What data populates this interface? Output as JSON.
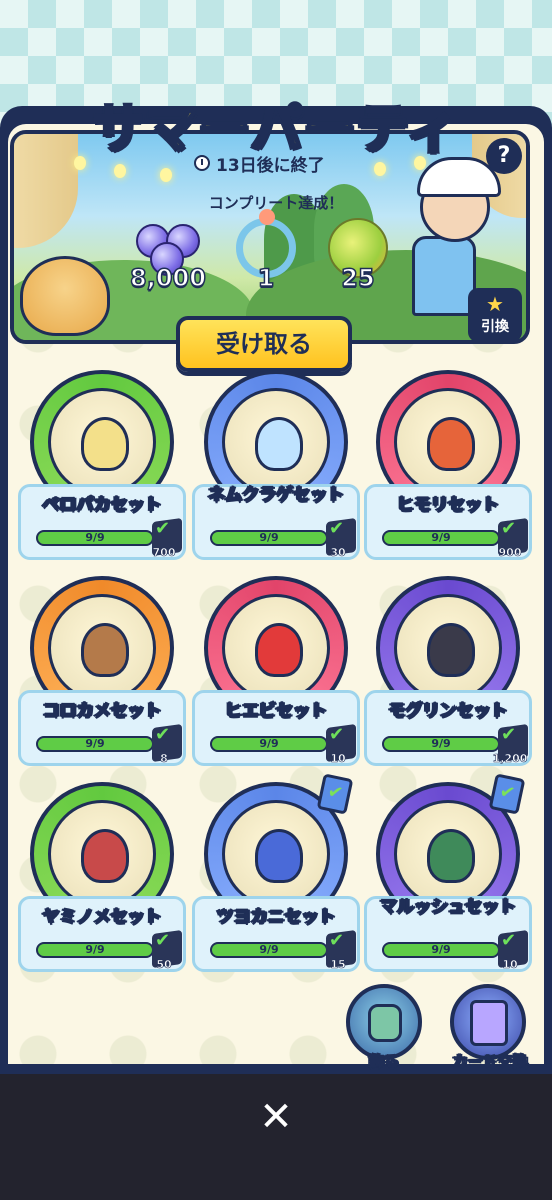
{
  "event": {
    "title": "サマーパーティ",
    "timer": "13日後に終了",
    "complete_label": "コンプリート達成！",
    "help": "?",
    "rewards": [
      {
        "icon": "gem-icon",
        "value": "8,000"
      },
      {
        "icon": "wreath-icon",
        "value": "1"
      },
      {
        "icon": "fruit-icon",
        "value": "25"
      }
    ],
    "exchange_label": "引換",
    "receive_label": "受け取る"
  },
  "sets": [
    {
      "name": "ペロパカセット",
      "progress": "9/9",
      "count": "700",
      "color": "#62c93f"
    },
    {
      "name": "ネムクラゲセット",
      "progress": "9/9",
      "count": "30",
      "color": "#5b86e8"
    },
    {
      "name": "ヒモリセット",
      "progress": "9/9",
      "count": "900",
      "color": "#e2446a"
    },
    {
      "name": "コロカメセット",
      "progress": "9/9",
      "count": "8",
      "color": "#f08a2a"
    },
    {
      "name": "ヒエビセット",
      "progress": "9/9",
      "count": "10",
      "color": "#e2446a"
    },
    {
      "name": "モグリンセット",
      "progress": "9/9",
      "count": "1,200",
      "color": "#6a4ad0"
    },
    {
      "name": "ヤミノメセット",
      "progress": "9/9",
      "count": "50",
      "color": "#62c93f"
    },
    {
      "name": "ツヨカニセット",
      "progress": "9/9",
      "count": "15",
      "color": "#5b86e8"
    },
    {
      "name": "マルッシュセット",
      "progress": "9/9",
      "count": "10",
      "color": "#6a4ad0"
    }
  ],
  "buttons": {
    "decorate": "飾る",
    "card_exchange": "カード交換"
  },
  "close": "✕"
}
